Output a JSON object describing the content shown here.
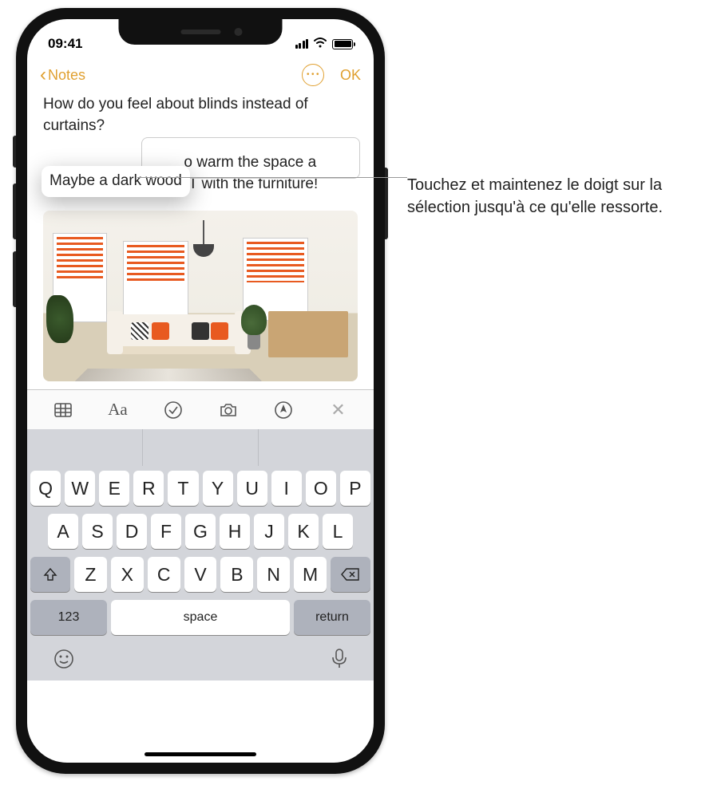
{
  "status": {
    "time": "09:41"
  },
  "nav": {
    "back_label": "Notes",
    "done_label": "OK"
  },
  "note": {
    "line1": "How do you feel about blinds instead of curtains?",
    "line2_obscured": "bit. Would look GREAT with the furniture!",
    "line2_visible_tail": "o warm the space a",
    "lifted_text": "Maybe a dark wood"
  },
  "keyboard": {
    "row1": [
      "Q",
      "W",
      "E",
      "R",
      "T",
      "Y",
      "U",
      "I",
      "O",
      "P"
    ],
    "row2": [
      "A",
      "S",
      "D",
      "F",
      "G",
      "H",
      "J",
      "K",
      "L"
    ],
    "row3": [
      "Z",
      "X",
      "C",
      "V",
      "B",
      "N",
      "M"
    ],
    "numeric_label": "123",
    "space_label": "space",
    "return_label": "return"
  },
  "callout": {
    "text": "Touchez et maintenez le doigt sur la sélection jusqu'à ce qu'elle ressorte."
  }
}
